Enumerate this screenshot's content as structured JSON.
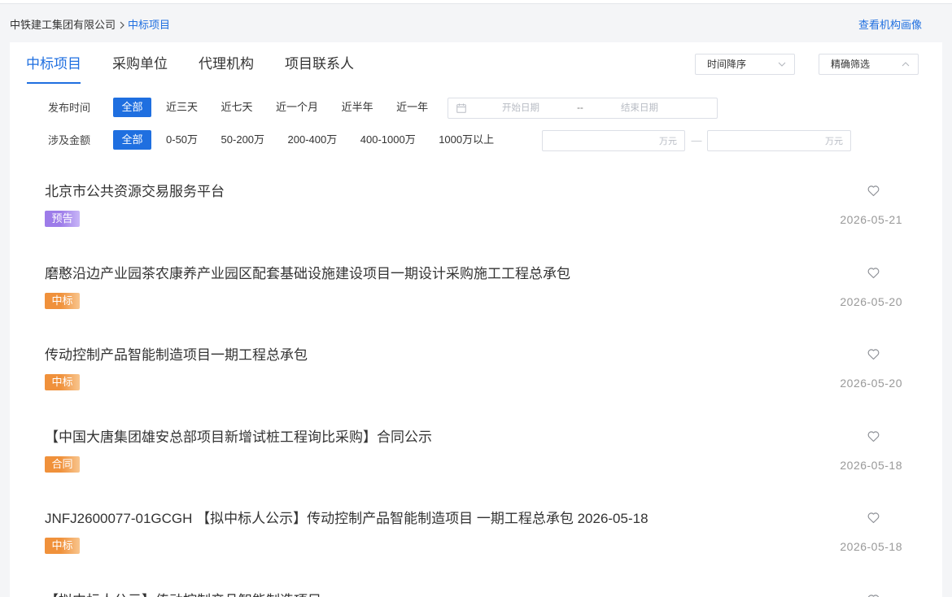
{
  "colors": {
    "primary": "#1f6fe0",
    "text": "#333333",
    "muted": "#999999",
    "border": "#dcdfe6",
    "page_background": "#f4f5f7"
  },
  "breadcrumb": {
    "root": "中铁建工集团有限公司",
    "separator_icon": "chevron-right-icon",
    "current": "中标项目"
  },
  "profile_link": "查看机构画像",
  "tabs": [
    {
      "label": "中标项目",
      "active": true
    },
    {
      "label": "采购单位",
      "active": false
    },
    {
      "label": "代理机构",
      "active": false
    },
    {
      "label": "项目联系人",
      "active": false
    }
  ],
  "sort_select": {
    "value": "时间降序",
    "icon": "chevron-down-icon"
  },
  "filter_select": {
    "value": "精确筛选",
    "icon": "chevron-up-icon"
  },
  "filters": {
    "publish_time": {
      "label": "发布时间",
      "options": [
        {
          "label": "全部",
          "selected": true
        },
        {
          "label": "近三天",
          "selected": false
        },
        {
          "label": "近七天",
          "selected": false
        },
        {
          "label": "近一个月",
          "selected": false
        },
        {
          "label": "近半年",
          "selected": false
        },
        {
          "label": "近一年",
          "selected": false
        }
      ],
      "date_range": {
        "icon": "calendar-icon",
        "start_placeholder": "开始日期",
        "separator": "--",
        "end_placeholder": "结束日期"
      }
    },
    "amount": {
      "label": "涉及金额",
      "options": [
        {
          "label": "全部",
          "selected": true
        },
        {
          "label": "0-50万",
          "selected": false
        },
        {
          "label": "50-200万",
          "selected": false
        },
        {
          "label": "200-400万",
          "selected": false
        },
        {
          "label": "400-1000万",
          "selected": false
        },
        {
          "label": "1000万以上",
          "selected": false
        }
      ],
      "min": {
        "unit": "万元"
      },
      "separator": "—",
      "max": {
        "unit": "万元"
      }
    }
  },
  "results": [
    {
      "title": "北京市公共资源交易服务平台",
      "tag": "预告",
      "tag_color": "#9d7ce9",
      "tag_color_light": "#c8b6f7",
      "date": "2026-05-21",
      "favorite_icon": "heart-outline-icon",
      "favorited": false
    },
    {
      "title": "磨憨沿边产业园茶农康养产业园区配套基础设施建设项目一期设计采购施工工程总承包",
      "tag": "中标",
      "tag_color": "#f0913b",
      "tag_color_light": "#f8c58e",
      "date": "2026-05-20",
      "favorite_icon": "heart-outline-icon",
      "favorited": false
    },
    {
      "title": "传动控制产品智能制造项目一期工程总承包",
      "tag": "中标",
      "tag_color": "#f0913b",
      "tag_color_light": "#f8c58e",
      "date": "2026-05-20",
      "favorite_icon": "heart-outline-icon",
      "favorited": false
    },
    {
      "title": "【中国大唐集团雄安总部项目新增试桩工程询比采购】合同公示",
      "tag": "合同",
      "tag_color": "#f0913b",
      "tag_color_light": "#f8c58e",
      "date": "2026-05-18",
      "favorite_icon": "heart-outline-icon",
      "favorited": false
    },
    {
      "title": "JNFJ2600077-01GCGH 【拟中标人公示】传动控制产品智能制造项目 一期工程总承包 2026-05-18",
      "tag": "中标",
      "tag_color": "#f0913b",
      "tag_color_light": "#f8c58e",
      "date": "2026-05-18",
      "favorite_icon": "heart-outline-icon",
      "favorited": false
    },
    {
      "title": "【拟中标人公示】传动控制产品智能制造项目",
      "favorite_icon": "heart-outline-icon",
      "favorited": false
    }
  ]
}
